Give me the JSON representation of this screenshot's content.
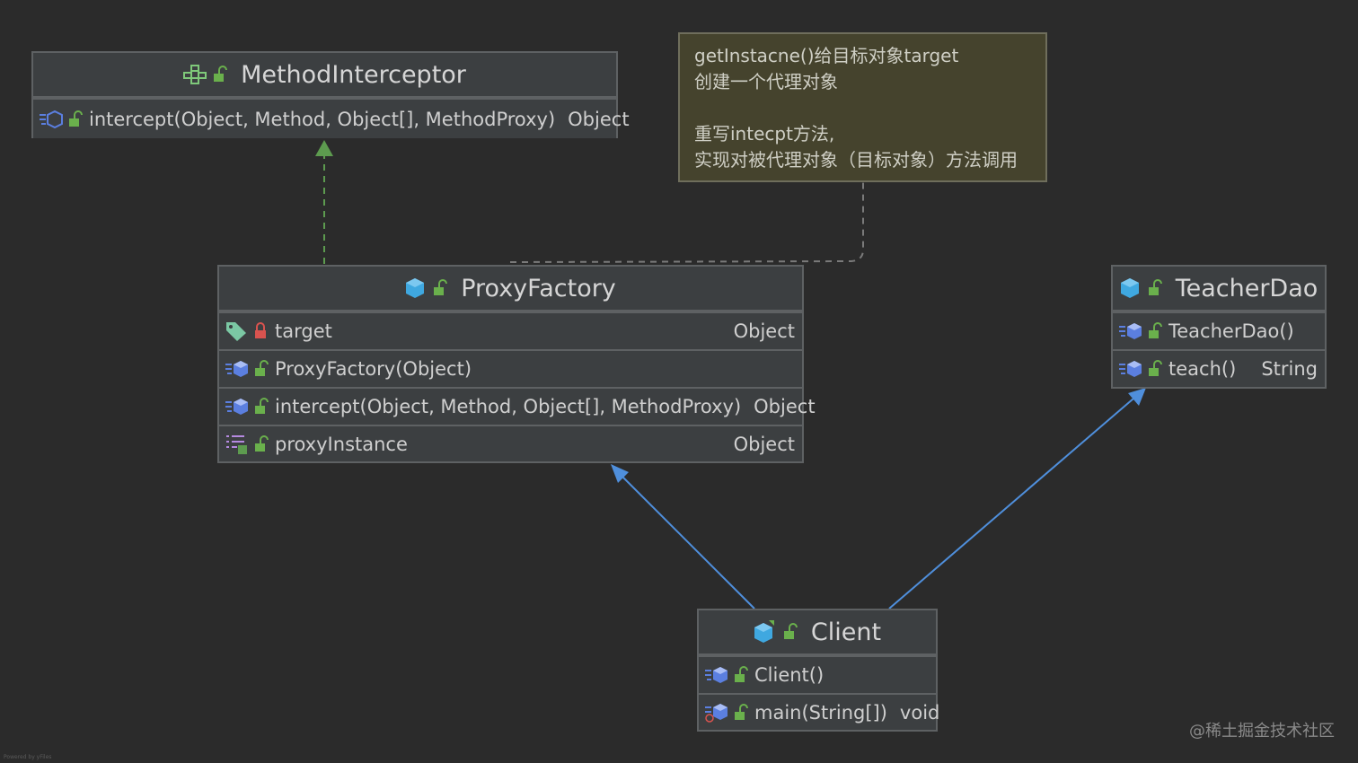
{
  "colors": {
    "background": "#2b2b2b",
    "box_fill": "#3c3f41",
    "box_border": "#5e6163",
    "note_fill": "#45432d",
    "implements_arrow": "#5d9b4f",
    "association_arrow": "#4f8fdc",
    "class_icon": "#3fa8e0",
    "method_icon": "#5b7fe0",
    "lock_open": "#6ab04c",
    "lock_private": "#d9534f",
    "field_tag": "#7bc8a4"
  },
  "note": {
    "lines": [
      "getInstacne()给目标对象target",
      "创建一个代理对象",
      "",
      "重写intecpt方法,",
      "实现对被代理对象（目标对象）方法调用"
    ]
  },
  "method_interceptor": {
    "title": "MethodInterceptor",
    "title_icon": "interface-icon",
    "rows": [
      {
        "name": "intercept(Object, Method, Object[], MethodProxy)",
        "type": "Object",
        "icon": "abstract-method-icon"
      }
    ]
  },
  "proxy_factory": {
    "title": "ProxyFactory",
    "title_icon": "class-icon",
    "rows": [
      {
        "name": "target",
        "type": "Object",
        "icon": "field-icon",
        "visibility": "private"
      },
      {
        "name": "ProxyFactory(Object)",
        "type": "",
        "icon": "method-icon",
        "visibility": "public"
      },
      {
        "name": "intercept(Object, Method, Object[], MethodProxy)",
        "type": "Object",
        "icon": "method-icon",
        "visibility": "public"
      },
      {
        "name": "proxyInstance",
        "type": "Object",
        "icon": "property-icon",
        "visibility": "public"
      }
    ]
  },
  "teacher_dao": {
    "title": "TeacherDao",
    "title_icon": "class-icon",
    "rows": [
      {
        "name": "TeacherDao()",
        "type": "",
        "icon": "method-icon",
        "visibility": "public"
      },
      {
        "name": "teach()",
        "type": "String",
        "icon": "method-icon",
        "visibility": "public"
      }
    ]
  },
  "client": {
    "title": "Client",
    "title_icon": "class-icon",
    "rows": [
      {
        "name": "Client()",
        "type": "",
        "icon": "method-icon",
        "visibility": "public"
      },
      {
        "name": "main(String[])",
        "type": "void",
        "icon": "main-method-icon",
        "visibility": "public"
      }
    ]
  },
  "watermark": "@稀土掘金技术社区",
  "footer_small": "Powered by yFiles"
}
